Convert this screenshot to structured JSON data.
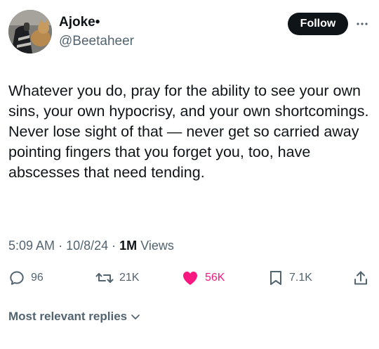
{
  "author": {
    "display_name": "Ajoke",
    "name_suffix": "•",
    "handle": "@Beetaheer"
  },
  "header": {
    "follow_label": "Follow",
    "more_icon": "more-horizontal-icon"
  },
  "tweet": {
    "text": "Whatever you do, pray for the ability to see your own sins, your own hypocrisy, and your own shortcomings. Never lose sight of that — never get so carried away pointing fingers that you forget you, too, have abscesses that need tending."
  },
  "meta": {
    "time": "5:09 AM",
    "date": "10/8/24",
    "views_count": "1M",
    "views_label": "Views",
    "separator": "·"
  },
  "actions": {
    "replies": {
      "icon": "reply-icon",
      "count": "96"
    },
    "retweets": {
      "icon": "retweet-icon",
      "count": "21K"
    },
    "likes": {
      "icon": "heart-filled-icon",
      "count": "56K",
      "color": "#f91880"
    },
    "bookmarks": {
      "icon": "bookmark-icon",
      "count": "7.1K"
    },
    "share": {
      "icon": "share-icon"
    }
  },
  "replies_sort": {
    "label": "Most relevant replies",
    "icon": "chevron-down-icon"
  },
  "colors": {
    "text_primary": "#0f1419",
    "text_secondary": "#536471",
    "like": "#f91880",
    "follow_bg": "#0f1419"
  }
}
